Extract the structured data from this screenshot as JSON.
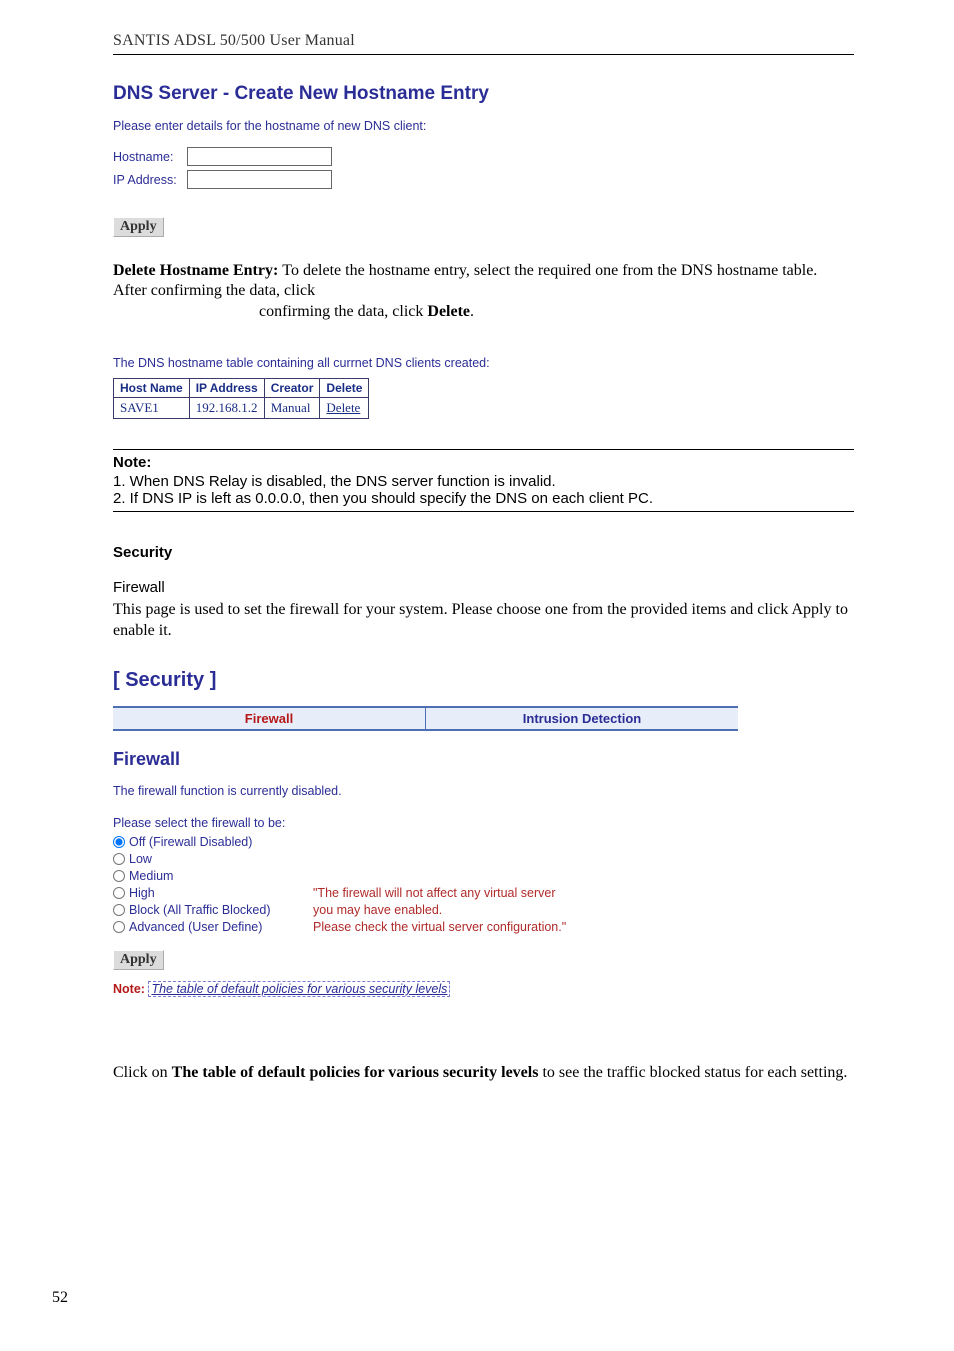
{
  "header": {
    "running": "SANTIS ADSL 50/500 User Manual"
  },
  "dns": {
    "title": "DNS Server - Create New Hostname Entry",
    "instr": "Please enter details for the hostname of new DNS client:",
    "hostname_label": "Hostname:",
    "ip_label": "IP Address:",
    "hostname_value": "",
    "ip_value": "",
    "apply_label": "Apply"
  },
  "delete_para": {
    "lead": "Delete Hostname Entry: ",
    "rest": "To delete the hostname entry, select the required one from the DNS hostname table. After confirming the data, click ",
    "bold2": "Delete",
    "tail": "."
  },
  "hn_table": {
    "caption": "The DNS hostname table containing all currnet DNS clients created:",
    "headers": [
      "Host Name",
      "IP Address",
      "Creator",
      "Delete"
    ],
    "rows": [
      {
        "host": "SAVE1",
        "ip": "192.168.1.2",
        "creator": "Manual",
        "action": "Delete"
      }
    ]
  },
  "note": {
    "head": "Note:",
    "l1": "1. When DNS Relay is disabled, the DNS server function is invalid.",
    "l2": "2. If DNS IP is left as 0.0.0.0, then you should specify the DNS on each client PC."
  },
  "security": {
    "heading": "Security",
    "subhead": "Firewall",
    "desc": "This page is used to set the firewall for your system. Please choose one from the provided items and click Apply to enable it.",
    "bracket": "[ Security ]",
    "tabs": {
      "firewall": "Firewall",
      "ids": "Intrusion Detection"
    },
    "fw_title": "Firewall",
    "status": "The firewall function is currently disabled.",
    "select_label": "Please select the firewall to be:",
    "options": {
      "off": "Off (Firewall Disabled)",
      "low": "Low",
      "medium": "Medium",
      "high": "High",
      "block": "Block (All Traffic Blocked)",
      "advanced": "Advanced (User Define)"
    },
    "selected": "off",
    "side_note_l1": "\"The firewall will not affect any virtual server",
    "side_note_l2": "you may have enabled.",
    "side_note_l3": "Please check the virtual server configuration.\"",
    "apply_label": "Apply",
    "note_label": "Note:",
    "note_link": "The table of default policies for various security levels"
  },
  "trailing": {
    "pre": "Click on ",
    "bold": "The table of default policies for various security levels",
    "post": " to see the traffic blocked status for each setting."
  },
  "page_number": "52"
}
